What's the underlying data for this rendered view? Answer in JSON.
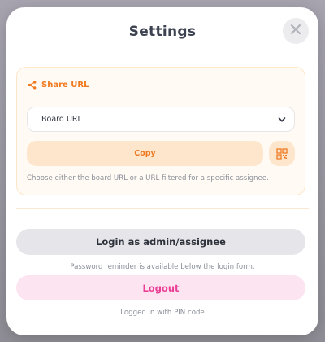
{
  "modal": {
    "title": "Settings",
    "close_icon": "close-icon"
  },
  "share": {
    "heading": "Share URL",
    "icon": "share-icon",
    "select": {
      "selected": "Board URL",
      "icon": "chevron-down-icon"
    },
    "copy_label": "Copy",
    "qr_icon": "qr-code-icon",
    "hint": "Choose either the board URL or a URL filtered for a specific assignee."
  },
  "auth": {
    "login_label": "Login as admin/assignee",
    "login_hint": "Password reminder is available below the login form.",
    "logout_label": "Logout",
    "logout_hint": "Logged in with PIN code"
  },
  "colors": {
    "accent_orange": "#f0781d",
    "logout_pink": "#ea3f95",
    "card_bg": "#fffaf3"
  }
}
